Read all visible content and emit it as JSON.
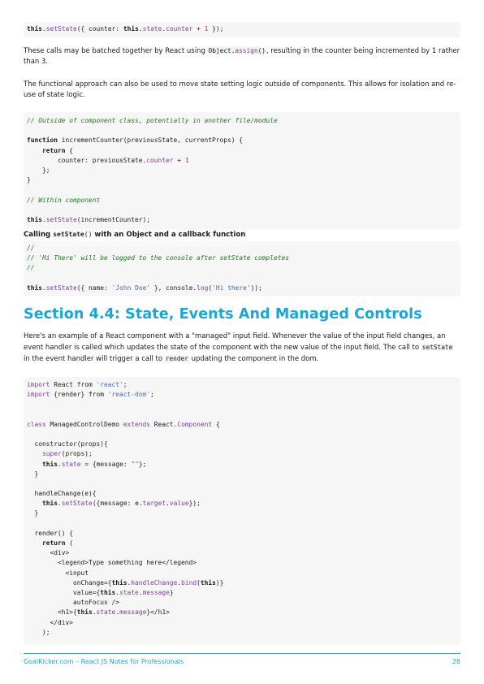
{
  "code1": {
    "lines": [
      [
        [
          "kw",
          "this"
        ],
        [
          "",
          "."
        ],
        [
          "pr",
          "setState"
        ],
        [
          "",
          "({ counter: "
        ],
        [
          "kw",
          "this"
        ],
        [
          "",
          "."
        ],
        [
          "pr",
          "state"
        ],
        [
          "",
          "."
        ],
        [
          "pr",
          "counter"
        ],
        [
          "",
          " + "
        ],
        [
          "nm",
          "1"
        ],
        [
          "",
          " });"
        ]
      ]
    ]
  },
  "para1": {
    "before": "These calls may be batched together by React using ",
    "code_a": "Object.",
    "code_b": "assign",
    "code_c": "()",
    "after": ", resulting in the counter being incremented by 1 rather than 3."
  },
  "para2": "The functional approach can also be used to move state setting logic outside of components. This allows for isolation and re-use of state logic.",
  "code2": {
    "lines": [
      [
        [
          "cm",
          "// Outside of component class, potentially in another file/module"
        ]
      ],
      [
        [
          "",
          ""
        ]
      ],
      [
        [
          "kw",
          "function"
        ],
        [
          "",
          " incrementCounter(previousState, currentProps) {"
        ]
      ],
      [
        [
          "",
          "    "
        ],
        [
          "kw",
          "return"
        ],
        [
          "",
          " {"
        ]
      ],
      [
        [
          "",
          "        counter: previousState."
        ],
        [
          "pr",
          "counter"
        ],
        [
          "",
          " + "
        ],
        [
          "nm",
          "1"
        ]
      ],
      [
        [
          "",
          "    };"
        ]
      ],
      [
        [
          "",
          "}"
        ]
      ],
      [
        [
          "",
          ""
        ]
      ],
      [
        [
          "cm",
          "// Within component"
        ]
      ],
      [
        [
          "",
          ""
        ]
      ],
      [
        [
          "kw",
          "this"
        ],
        [
          "",
          "."
        ],
        [
          "pr",
          "setState"
        ],
        [
          "",
          "(incrementCounter);"
        ]
      ]
    ]
  },
  "heading3": {
    "before": "Calling ",
    "code": "setState",
    "code_paren": "()",
    "after": " with an Object and a callback function"
  },
  "code3": {
    "lines": [
      [
        [
          "cm",
          "//"
        ]
      ],
      [
        [
          "cm",
          "// 'Hi There' will be logged to the console after setState completes"
        ]
      ],
      [
        [
          "cm",
          "//"
        ]
      ],
      [
        [
          "",
          ""
        ]
      ],
      [
        [
          "kw",
          "this"
        ],
        [
          "",
          "."
        ],
        [
          "pr",
          "setState"
        ],
        [
          "",
          "({ name: "
        ],
        [
          "st",
          "'John Doe'"
        ],
        [
          "",
          " }, console."
        ],
        [
          "pr",
          "log"
        ],
        [
          "",
          "("
        ],
        [
          "st",
          "'Hi there'"
        ],
        [
          "",
          "));"
        ]
      ]
    ]
  },
  "section_title": "Section 4.4: State, Events And Managed Controls",
  "para3": {
    "t1": "Here's an example of a React component with a \"managed\" input field. Whenever the value of the input field changes, an event handler is called which updates the state of the component with the new value of the input field. The call to ",
    "c1": "setState",
    "t2": " in the event handler will trigger a call to ",
    "c2": "render",
    "t3": " updating the component in the dom."
  },
  "code4": {
    "lines": [
      [
        [
          "kwp",
          "import"
        ],
        [
          "",
          " React from "
        ],
        [
          "st",
          "'react'"
        ],
        [
          "",
          ";"
        ]
      ],
      [
        [
          "kwp",
          "import"
        ],
        [
          "",
          " {render} from "
        ],
        [
          "st",
          "'react-dom'"
        ],
        [
          "",
          ";"
        ]
      ],
      [
        [
          "",
          ""
        ]
      ],
      [
        [
          "",
          ""
        ]
      ],
      [
        [
          "kwp",
          "class"
        ],
        [
          "",
          " ManagedControlDemo "
        ],
        [
          "kwp",
          "extends"
        ],
        [
          "",
          " React."
        ],
        [
          "pr",
          "Component"
        ],
        [
          "",
          " {"
        ]
      ],
      [
        [
          "",
          ""
        ]
      ],
      [
        [
          "",
          "  constructor(props){"
        ]
      ],
      [
        [
          "",
          "    "
        ],
        [
          "kwp",
          "super"
        ],
        [
          "",
          "(props);"
        ]
      ],
      [
        [
          "",
          "    "
        ],
        [
          "kw",
          "this"
        ],
        [
          "",
          "."
        ],
        [
          "pr",
          "state"
        ],
        [
          "",
          " = {message: "
        ],
        [
          "st",
          "\"\""
        ],
        [
          "",
          "};"
        ]
      ],
      [
        [
          "",
          "  }"
        ]
      ],
      [
        [
          "",
          ""
        ]
      ],
      [
        [
          "",
          "  handleChange(e){"
        ]
      ],
      [
        [
          "",
          "    "
        ],
        [
          "kw",
          "this"
        ],
        [
          "",
          "."
        ],
        [
          "pr",
          "setState"
        ],
        [
          "",
          "({message: e."
        ],
        [
          "pr",
          "target"
        ],
        [
          "",
          "."
        ],
        [
          "pr",
          "value"
        ],
        [
          "",
          "});"
        ]
      ],
      [
        [
          "",
          "  }"
        ]
      ],
      [
        [
          "",
          ""
        ]
      ],
      [
        [
          "",
          "  render() {"
        ]
      ],
      [
        [
          "",
          "    "
        ],
        [
          "kw",
          "return"
        ],
        [
          "",
          " ("
        ]
      ],
      [
        [
          "",
          "      <div>"
        ]
      ],
      [
        [
          "",
          "        <legend>Type something here</legend>"
        ]
      ],
      [
        [
          "",
          "          <input"
        ]
      ],
      [
        [
          "",
          "            onChange={"
        ],
        [
          "kw",
          "this"
        ],
        [
          "",
          "."
        ],
        [
          "pr",
          "handleChange"
        ],
        [
          "",
          "."
        ],
        [
          "pr",
          "bind"
        ],
        [
          "",
          "("
        ],
        [
          "kw",
          "this"
        ],
        [
          "",
          ")}"
        ]
      ],
      [
        [
          "",
          "            value={"
        ],
        [
          "kw",
          "this"
        ],
        [
          "",
          "."
        ],
        [
          "pr",
          "state"
        ],
        [
          "",
          "."
        ],
        [
          "pr",
          "message"
        ],
        [
          "",
          "}"
        ]
      ],
      [
        [
          "",
          "            autoFocus />"
        ]
      ],
      [
        [
          "",
          "        <h1>{"
        ],
        [
          "kw",
          "this"
        ],
        [
          "",
          "."
        ],
        [
          "pr",
          "state"
        ],
        [
          "",
          "."
        ],
        [
          "pr",
          "message"
        ],
        [
          "",
          "}</h1>"
        ]
      ],
      [
        [
          "",
          "      </div>"
        ]
      ],
      [
        [
          "",
          "    );"
        ]
      ]
    ]
  },
  "footer": {
    "left": "GoalKicker.com – React JS Notes for Professionals",
    "right": "28"
  }
}
